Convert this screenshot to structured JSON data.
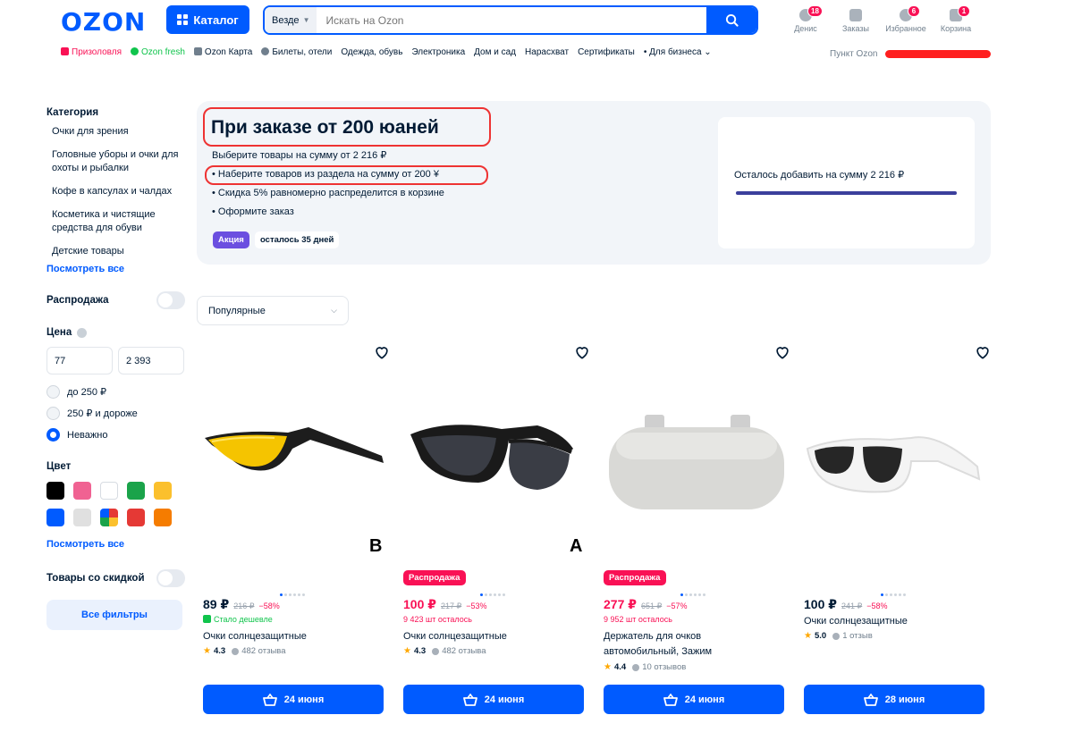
{
  "header": {
    "logo": "OZON",
    "catalog_label": "Каталог",
    "search_scope": "Везде",
    "search_placeholder": "Искать на Ozon",
    "icons": [
      {
        "label": "Денис",
        "badge": "18",
        "icon": "user-icon"
      },
      {
        "label": "Заказы",
        "badge": "",
        "icon": "box-icon"
      },
      {
        "label": "Избранное",
        "badge": "6",
        "icon": "heart-icon"
      },
      {
        "label": "Корзина",
        "badge": "1",
        "icon": "cart-icon"
      }
    ]
  },
  "nav": {
    "items": [
      "Призоловля",
      "Ozon fresh",
      "Ozon Карта",
      "Билеты, отели",
      "Одежда, обувь",
      "Электроника",
      "Дом и сад",
      "Нарасхват",
      "Сертификаты",
      "Для бизнеса"
    ],
    "pickup": "Пункт Ozon"
  },
  "sidebar": {
    "category_heading": "Категория",
    "categories": [
      "Очки для зрения",
      "Головные уборы и очки для охоты и рыбалки",
      "Кофе в капсулах и чалдах",
      "Косметика и чистящие средства для обуви",
      "Детские товары"
    ],
    "see_all": "Посмотреть все",
    "sale_label": "Распродажа",
    "price_heading": "Цена",
    "price_from": "77",
    "price_to": "2 393",
    "price_options": [
      "до 250 ₽",
      "250 ₽ и дороже",
      "Неважно"
    ],
    "price_selected": 2,
    "color_heading": "Цвет",
    "colors": [
      "#000000",
      "#f06292",
      "#ffffff",
      "#1aa34a",
      "#fbc02d",
      "#005bff",
      "#e0e0e0",
      "multicolor",
      "#e53935",
      "#f57c00"
    ],
    "colors_see_all": "Посмотреть все",
    "discount_label": "Товары со скидкой",
    "all_filters": "Все фильтры"
  },
  "promo": {
    "title": "При заказе от 200 юаней",
    "subtitle": "Выберите товары на сумму от 2 216 ₽",
    "bullets": [
      "• Наберите товаров из раздела на сумму от 200 ¥",
      "• Скидка 5% равномерно распределится в корзине",
      "• Оформите заказ"
    ],
    "tag": "Акция",
    "days_left": "осталось 35 дней",
    "remaining_text": "Осталось добавить на сумму 2 216 ₽",
    "progress_percent": 100,
    "accent_color": "#e33333"
  },
  "sort": {
    "selected": "Популярные"
  },
  "products": [
    {
      "letter": "B",
      "sale_tag": "",
      "price": "89 ₽",
      "old_price": "216 ₽",
      "discount": "−58%",
      "note": "Стало дешевле",
      "note_type": "green",
      "title": "Очки солнцезащитные",
      "rating": "4.3",
      "reviews": "482 отзыва",
      "delivery": "24 июня"
    },
    {
      "letter": "A",
      "sale_tag": "Распродажа",
      "price": "100 ₽",
      "old_price": "217 ₽",
      "discount": "−53%",
      "note": "9 423 шт осталось",
      "note_type": "pink",
      "title": "Очки солнцезащитные",
      "rating": "4.3",
      "reviews": "482 отзыва",
      "delivery": "24 июня"
    },
    {
      "letter": "",
      "sale_tag": "Распродажа",
      "price": "277 ₽",
      "old_price": "651 ₽",
      "discount": "−57%",
      "note": "9 952 шт осталось",
      "note_type": "pink",
      "title": "Держатель для очков автомобильный, Зажим",
      "rating": "4.4",
      "reviews": "10 отзывов",
      "delivery": "24 июня"
    },
    {
      "letter": "",
      "sale_tag": "",
      "price": "100 ₽",
      "old_price": "241 ₽",
      "discount": "−58%",
      "note": "",
      "note_type": "",
      "title": "Очки солнцезащитные",
      "rating": "5.0",
      "reviews": "1 отзыв",
      "delivery": "28 июня"
    }
  ]
}
